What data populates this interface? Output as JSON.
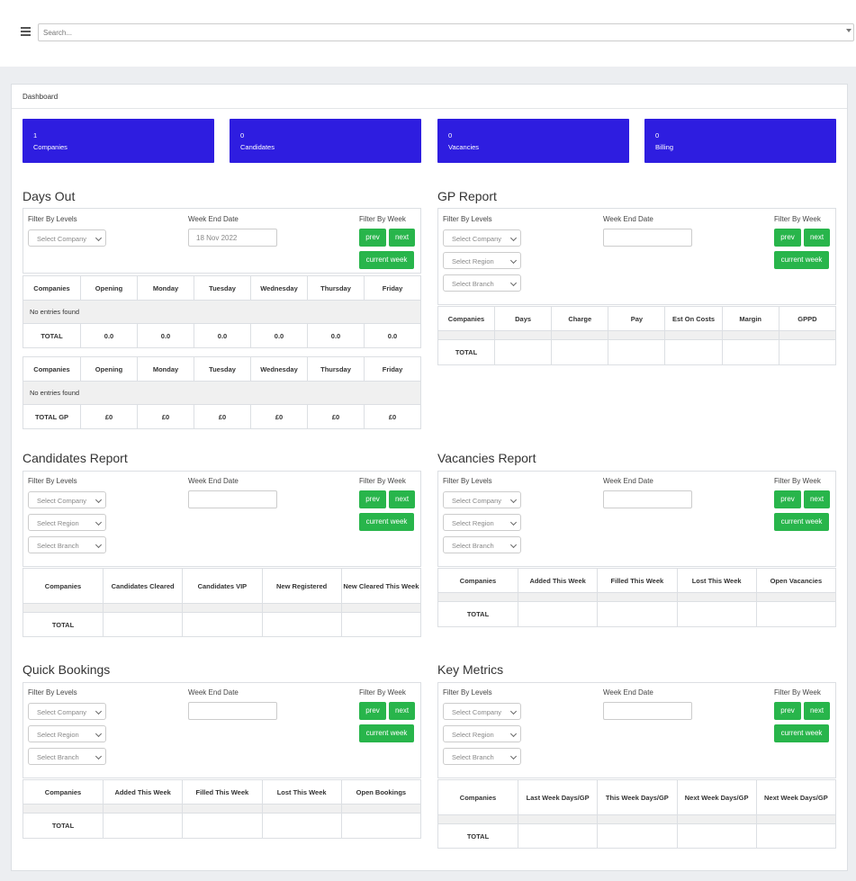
{
  "search": {
    "placeholder": "Search..."
  },
  "breadcrumb": "Dashboard",
  "stats": [
    {
      "value": "1",
      "label": "Companies"
    },
    {
      "value": "0",
      "label": "Candidates"
    },
    {
      "value": "0",
      "label": "Vacancies"
    },
    {
      "value": "0",
      "label": "Billing"
    }
  ],
  "common": {
    "filter_by_levels": "Filter By Levels",
    "week_end_date": "Week End Date",
    "filter_by_week": "Filter By Week",
    "select_company": "Select Company",
    "select_region": "Select Region",
    "select_branch": "Select Branch",
    "prev": "prev",
    "next": "next",
    "current_week": "current week",
    "total": "TOTAL",
    "no_entries": "No entries found"
  },
  "days_out": {
    "title": "Days Out",
    "week_end_date_value": "18 Nov 2022",
    "columns": [
      "Companies",
      "Opening",
      "Monday",
      "Tuesday",
      "Wednesday",
      "Thursday",
      "Friday"
    ],
    "totals": [
      "0.0",
      "0.0",
      "0.0",
      "0.0",
      "0.0",
      "0.0"
    ],
    "total_gp_label": "TOTAL GP",
    "gp_totals": [
      "£0",
      "£0",
      "£0",
      "£0",
      "£0",
      "£0"
    ]
  },
  "gp_report": {
    "title": "GP Report",
    "columns": [
      "Companies",
      "Days",
      "Charge",
      "Pay",
      "Est On Costs",
      "Margin",
      "GPPD"
    ]
  },
  "candidates_report": {
    "title": "Candidates Report",
    "columns": [
      "Companies",
      "Candidates Cleared",
      "Candidates VIP",
      "New Registered",
      "New Cleared This Week"
    ]
  },
  "vacancies_report": {
    "title": "Vacancies Report",
    "columns": [
      "Companies",
      "Added This Week",
      "Filled This Week",
      "Lost This Week",
      "Open Vacancies"
    ]
  },
  "quick_bookings": {
    "title": "Quick Bookings",
    "columns": [
      "Companies",
      "Added This Week",
      "Filled This Week",
      "Lost This Week",
      "Open Bookings"
    ]
  },
  "key_metrics": {
    "title": "Key Metrics",
    "columns": [
      "Companies",
      "Last Week Days/GP",
      "This Week Days/GP",
      "Next Week Days/GP",
      "Next Week Days/GP"
    ]
  }
}
